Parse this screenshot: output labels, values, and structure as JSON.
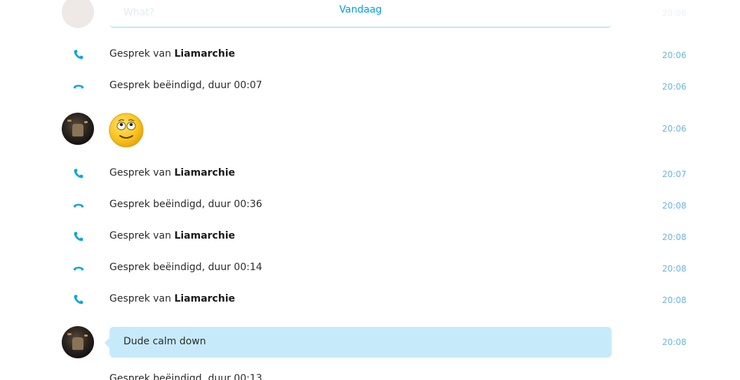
{
  "conversation": {
    "date_separator": "Vandaag",
    "faded_message": "What?",
    "faded_time": "20:06",
    "events": [
      {
        "type": "call_in",
        "prefix": "Gesprek van ",
        "name": "Liamarchie",
        "time": "20:06"
      },
      {
        "type": "call_end",
        "text": "Gesprek beëindigd, duur 00:07",
        "time": "20:06"
      },
      {
        "type": "emoji",
        "icon": "eyes-rolling-smiley-icon",
        "time": "20:06"
      },
      {
        "type": "call_in",
        "prefix": "Gesprek van ",
        "name": "Liamarchie",
        "time": "20:07"
      },
      {
        "type": "call_end",
        "text": "Gesprek beëindigd, duur 00:36",
        "time": "20:08"
      },
      {
        "type": "call_in",
        "prefix": "Gesprek van ",
        "name": "Liamarchie",
        "time": "20:08"
      },
      {
        "type": "call_end",
        "text": "Gesprek beëindigd, duur 00:14",
        "time": "20:08"
      },
      {
        "type": "call_in",
        "prefix": "Gesprek van ",
        "name": "Liamarchie",
        "time": "20:08"
      },
      {
        "type": "message",
        "text": "Dude calm down",
        "time": "20:08"
      }
    ],
    "cutoff_text": "Gesprek beëindigd, duur 00:13"
  },
  "colors": {
    "accent": "#00a0d8",
    "bubble": "#c7eafb",
    "time": "#6ab6dc"
  }
}
